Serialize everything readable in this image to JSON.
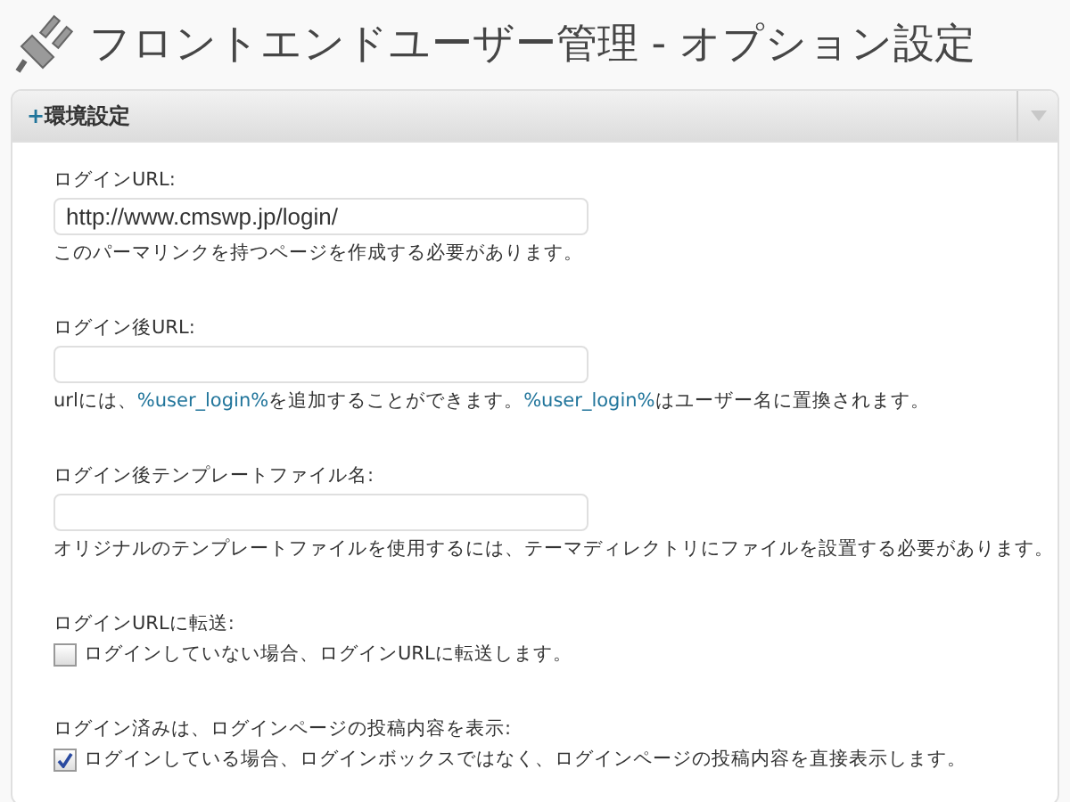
{
  "page_title": "フロントエンドユーザー管理 - オプション設定",
  "panel": {
    "title": "環境設定",
    "expand_mark": "+",
    "fields": [
      {
        "kind": "text",
        "label": "ログインURL:",
        "value": "http://www.cmswp.jp/login/",
        "description": [
          {
            "text": "このパーマリンクを持つページを作成する必要があります。",
            "kind": "plain"
          }
        ]
      },
      {
        "kind": "text",
        "label": "ログイン後URL:",
        "description": [
          {
            "text": "urlには、",
            "kind": "plain"
          },
          {
            "text": "%user_login%",
            "kind": "code"
          },
          {
            "text": "を追加することができます。",
            "kind": "plain"
          },
          {
            "text": "%user_login%",
            "kind": "code"
          },
          {
            "text": "はユーザー名に置換されます。",
            "kind": "plain"
          }
        ]
      },
      {
        "kind": "text",
        "label": "ログイン後テンプレートファイル名:",
        "description": [
          {
            "text": "オリジナルのテンプレートファイルを使用するには、テーマディレクトリにファイルを設置する必要があります。",
            "kind": "plain"
          }
        ]
      },
      {
        "kind": "checkbox",
        "label": "ログインURLに転送:",
        "checkbox_label": "ログインしていない場合、ログインURLに転送します。",
        "checked": false
      },
      {
        "kind": "checkbox",
        "label": "ログイン済みは、ログインページの投稿内容を表示:",
        "checkbox_label": "ログインしている場合、ログインボックスではなく、ログインページの投稿内容を直接表示します。",
        "checked": true
      }
    ]
  }
}
